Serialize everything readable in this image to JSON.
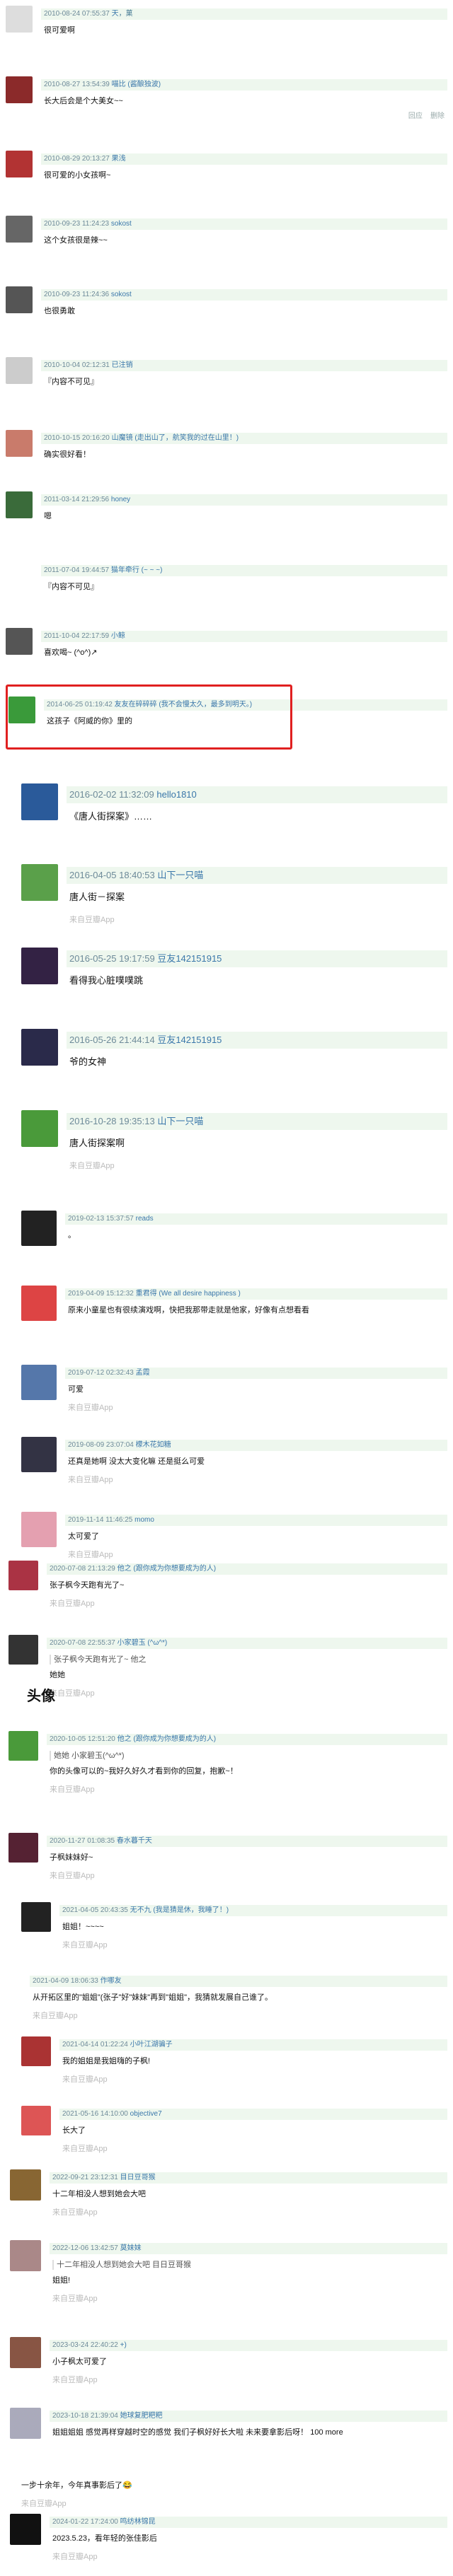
{
  "comments": [
    {
      "time": "2010-08-24 07:55:37",
      "user": "天",
      "suffix": "，菓",
      "text": "很可爱啊"
    },
    {
      "time": "2010-08-27 13:54:39",
      "user": "喵比 (酱酿独波)",
      "text": "长大后会是个大美女~~"
    },
    {
      "time": "2010-08-29 20:13:27",
      "user": "果浅",
      "text": "很可爱的小女孩啊~"
    },
    {
      "time": "2010-09-23 11:24:23",
      "user": "sokost",
      "text": "这个女孩很是辣~~"
    },
    {
      "time": "2010-09-23 11:24:36",
      "user": "sokost",
      "text": "也很勇敢"
    },
    {
      "time": "2010-10-04 02:12:31",
      "user": "已注销",
      "text": "『内容不可见』"
    },
    {
      "time": "2010-10-15 20:16:20",
      "user": "山魔镜 (走出山了，航笑我的过在山里！)",
      "text": "确实很好看！"
    },
    {
      "time": "2011-03-14 21:29:56",
      "user": "honey",
      "text": "嗯"
    },
    {
      "time": "2011-07-04 19:44:57",
      "user": "猫年牵行 (~ ~ ~)",
      "text": "『内容不可见』"
    },
    {
      "time": "2011-10-04 22:17:59",
      "user": "小鲸",
      "text": "喜欢喝~ (^o^)↗"
    },
    {
      "time": "2014-06-25 01:19:42",
      "user": "友友在碎碎碎 (我不会慢太久，最多到明天。)",
      "text": "这孩子《阿威的你》里的"
    },
    {
      "time": "2016-02-02 11:32:09",
      "user": "hello1810",
      "text": "《唐人街探案》……"
    },
    {
      "time": "2016-04-05 18:40:53",
      "user": "山下一只喵",
      "text": "唐人街－探案",
      "source": "来自豆瓣App"
    },
    {
      "time": "2016-05-25 19:17:59",
      "user": "豆友142151915",
      "text": "看得我心脏噗噗跳"
    },
    {
      "time": "2016-05-26 21:44:14",
      "user": "豆友142151915",
      "text": "爷的女神"
    },
    {
      "time": "2016-10-28 19:35:13",
      "user": "山下一只喵",
      "text": "唐人街探案啊",
      "source": "来自豆瓣App"
    },
    {
      "time": "2019-02-13 15:37:57",
      "user": "reads",
      "text": "。"
    },
    {
      "time": "2019-04-09 15:12:32",
      "user": "重君得 (We all desire happiness )",
      "text": "原来小童星也有很续演戏啊，快把我那带走就是他家，好像有点想看看"
    },
    {
      "time": "2019-07-12 02:32:43",
      "user": "孟霞",
      "text": "可爱",
      "source": "来自豆瓣App"
    },
    {
      "time": "2019-08-09 23:07:04",
      "user": "檬木花如糖",
      "text": "还真是她啊 没太大变化嘛 还是挺么可爱",
      "source": "来自豆瓣App"
    },
    {
      "time": "2019-11-14 11:46:25",
      "user": "momo",
      "text": "太可爱了",
      "source": "来自豆瓣App"
    },
    {
      "time": "2020-07-08 21:13:29",
      "user": "他之 (跟你成为你想要成为的人)",
      "text": "张子枫今天跑有光了~",
      "source": "来自豆瓣App"
    },
    {
      "time": "2020-07-08 22:55:37",
      "user": "小家碧玉 (^ω^*)",
      "reply": "张子枫今天跑有光了~  他之",
      "text": "她她",
      "source": "来自豆瓣App"
    },
    {
      "time": "2020-10-05 12:51:20",
      "user": "他之 (跟你成为你想要成为的人)",
      "reply": "她她  小家碧玉(^ω^*)",
      "text": "你的头像可以的~我好久好久才看到你的回复，抱歉~！",
      "source": "来自豆瓣App"
    },
    {
      "time": "2020-11-27 01:08:35",
      "user": "春水暮千天",
      "text": "子枫妹妹好~",
      "source": "来自豆瓣App"
    },
    {
      "time": "2021-04-05 20:43:35",
      "user": "无不九 (我是猜是休，我睡了！)",
      "text": "姐姐！~~~~",
      "source": "来自豆瓣App"
    },
    {
      "time": "2021-04-09 18:06:33",
      "user": "作哪友",
      "text": "从开拓区里的\"姐姐\"(张子\"好\"妹妹\"再到\"姐姐\"，我猜就发展自己谁了。",
      "source": "来自豆瓣App"
    },
    {
      "time": "2021-04-14 01:22:24",
      "user": "小叶江湖骗子",
      "text": "我的姐姐是我姐嗨的子枫!",
      "source": "来自豆瓣App"
    },
    {
      "time": "2021-05-16 14:10:00",
      "user": "objective7",
      "text": "长大了",
      "source": "来自豆瓣App"
    },
    {
      "time": "2022-09-21 23:12:31",
      "user": "目日豆哥猴",
      "text": "十二年相没人想到她会大吧",
      "source": "来自豆瓣App"
    },
    {
      "time": "2022-12-06 13:42:57",
      "user": "莫妹妹",
      "reply": "十二年相没人想到她会大吧  目日豆哥猴",
      "text": "姐姐!",
      "source": "来自豆瓣App"
    },
    {
      "time": "2023-03-24 22:40:22",
      "user": "+)",
      "text": "小子枫太可爱了",
      "source": "来自豆瓣App"
    },
    {
      "time": "2023-10-18 21:39:04",
      "user": "她球复肥粑粑",
      "text": "姐姐姐姐 感觉再样穿越时空的感觉 我们子枫好好长大啦 未来要拿影后呀！  100 more"
    },
    {
      "time": "",
      "user": "",
      "text": "一步十余年，今年真事影后了😂",
      "source": "来自豆瓣App"
    },
    {
      "time": "2024-01-22 17:24:00",
      "user": "鸣纺林锦昆",
      "text": "2023.5.23，看年轻的张佳影后",
      "source": "来自豆瓣App"
    }
  ],
  "labels": {
    "reply": "回应",
    "delete": "删除",
    "section_title": "头像"
  },
  "colors": {
    "header_bg": "#eef7ee",
    "highlight": "#e02020",
    "link": "#3a77aa"
  }
}
